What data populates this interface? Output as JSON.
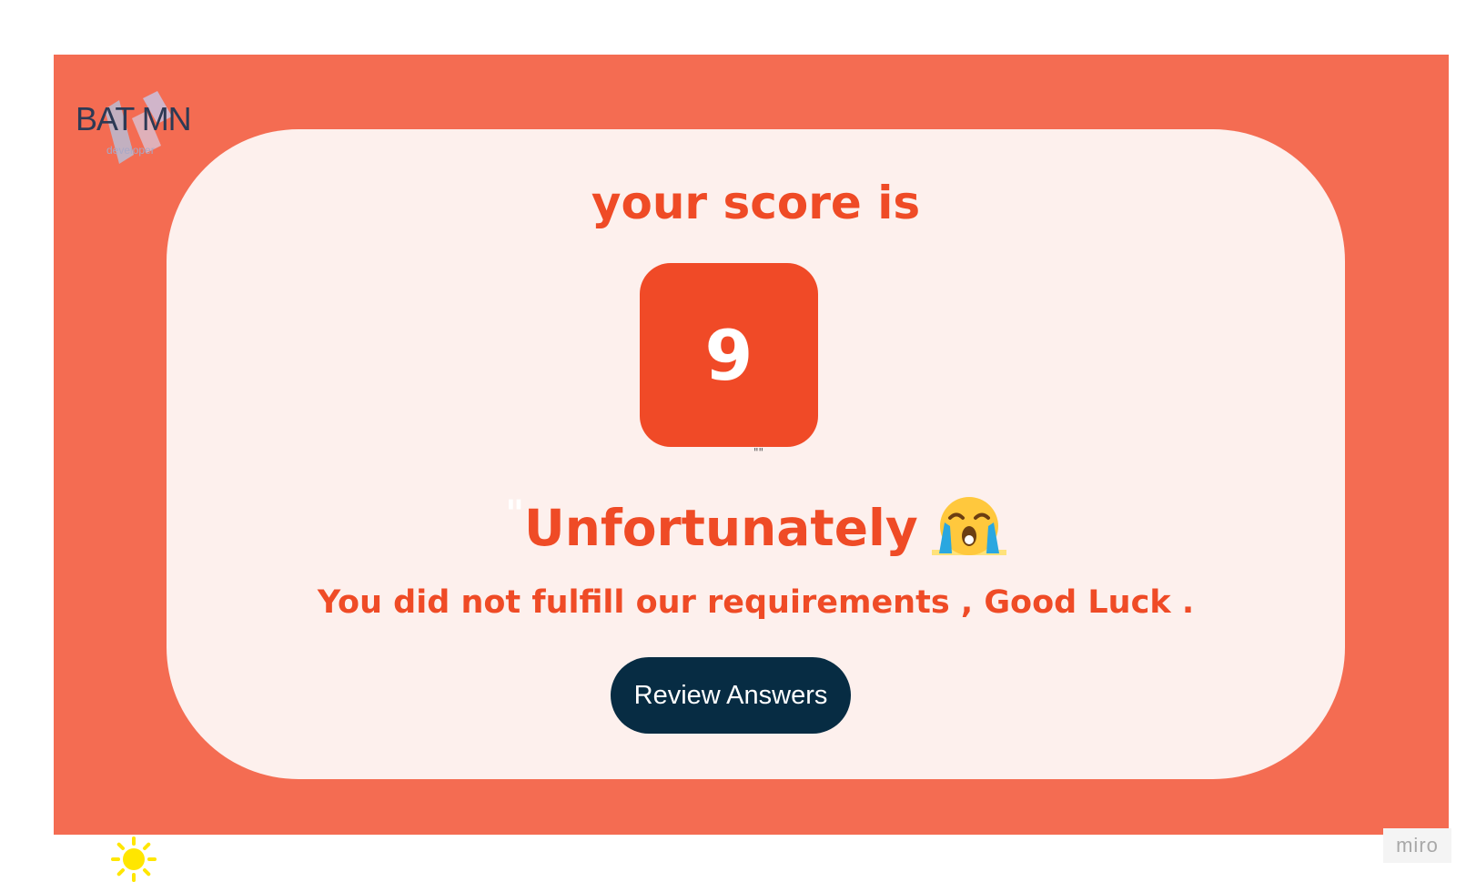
{
  "brand": {
    "logo_text": "BAT MN",
    "logo_subtext": "developer"
  },
  "result": {
    "heading": "your score is",
    "score": "9",
    "tiny_quotes": "\"\"",
    "open_quote": "\"",
    "verdict": "Unfortunately",
    "verdict_icon": "loudly-crying-face-icon",
    "message": "You did not fulfill our requirements , Good Luck ."
  },
  "actions": {
    "review_label": "Review Answers"
  },
  "footer": {
    "theme_icon": "sun-icon",
    "badge_text": "miro"
  },
  "colors": {
    "background_frame": "#f46c52",
    "card": "#fdf0ed",
    "accent": "#ef4b26",
    "score_box": "#f04a27",
    "button": "#072c43",
    "sun": "#ffe600"
  }
}
